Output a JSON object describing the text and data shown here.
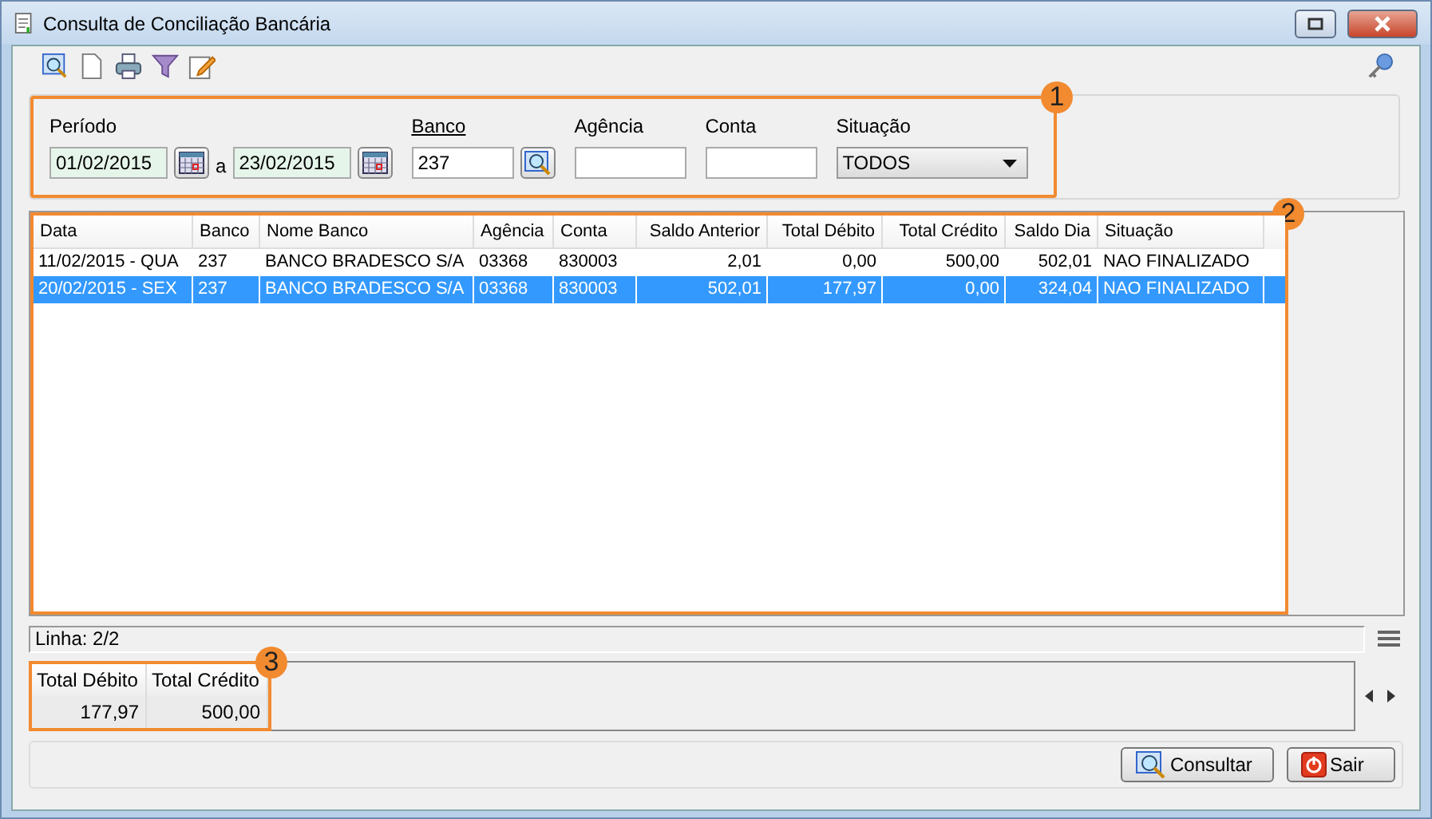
{
  "window": {
    "title": "Consulta de Conciliação Bancária"
  },
  "filters": {
    "badge": "1",
    "period": {
      "label": "Período",
      "from": "01/02/2015",
      "separator": "a",
      "to": "23/02/2015"
    },
    "bank": {
      "label": "Banco",
      "value": "237"
    },
    "agency": {
      "label": "Agência"
    },
    "account": {
      "label": "Conta"
    },
    "status": {
      "label": "Situação",
      "value": "TODOS"
    }
  },
  "table": {
    "badge": "2",
    "columns": [
      {
        "label": "Data",
        "kind": "text"
      },
      {
        "label": "Banco",
        "kind": "text"
      },
      {
        "label": "Nome Banco",
        "kind": "text"
      },
      {
        "label": "Agência",
        "kind": "text"
      },
      {
        "label": "Conta",
        "kind": "text"
      },
      {
        "label": "Saldo Anterior",
        "kind": "number"
      },
      {
        "label": "Total Débito",
        "kind": "number"
      },
      {
        "label": "Total Crédito",
        "kind": "number"
      },
      {
        "label": "Saldo Dia",
        "kind": "number"
      },
      {
        "label": "Situação",
        "kind": "text"
      }
    ],
    "rows": [
      {
        "selected": false,
        "cells": [
          "11/02/2015 - QUA",
          "237",
          "BANCO BRADESCO S/A",
          "03368",
          "830003",
          "2,01",
          "0,00",
          "500,00",
          "502,01",
          "NAO FINALIZADO"
        ]
      },
      {
        "selected": true,
        "cells": [
          "20/02/2015 - SEX",
          "237",
          "BANCO BRADESCO S/A",
          "03368",
          "830003",
          "502,01",
          "177,97",
          "0,00",
          "324,04",
          "NAO FINALIZADO"
        ]
      }
    ]
  },
  "status_bar": {
    "text": "Linha: 2/2"
  },
  "totals": {
    "badge": "3",
    "columns": [
      "Total Débito",
      "Total Crédito"
    ],
    "values": [
      "177,97",
      "500,00"
    ]
  },
  "buttons": [
    {
      "label": "Consultar",
      "kind": "search"
    },
    {
      "label": "Sair",
      "kind": "exit"
    }
  ]
}
